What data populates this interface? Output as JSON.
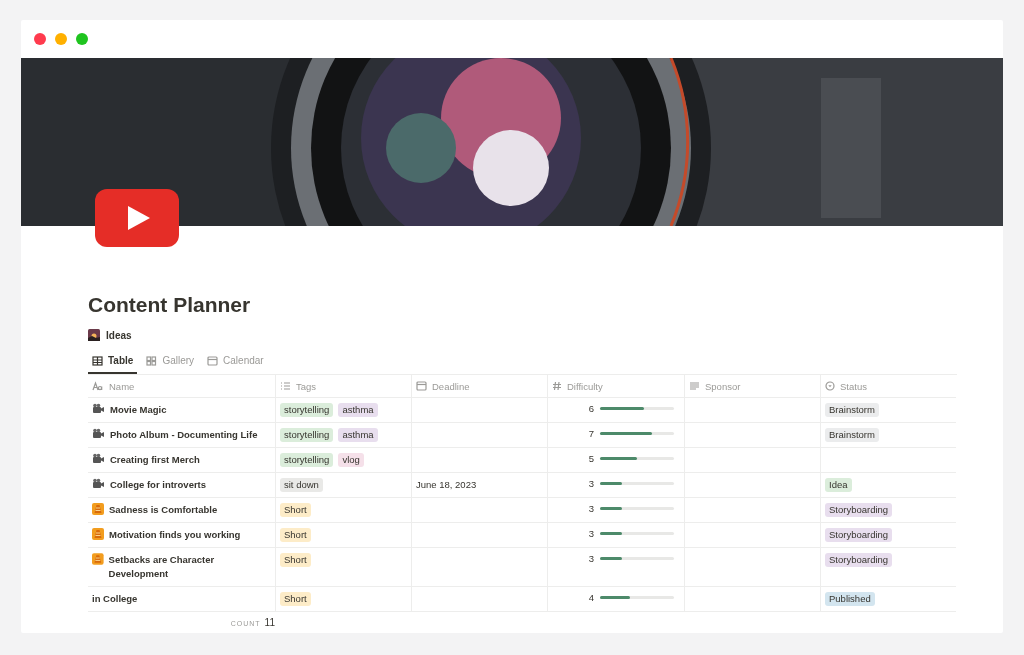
{
  "window": {
    "controls": [
      {
        "color": "#ff3b4e"
      },
      {
        "color": "#ffb000"
      },
      {
        "color": "#1fc41f"
      }
    ]
  },
  "page": {
    "title": "Content Planner",
    "subtitle": "Ideas"
  },
  "tabs": [
    {
      "label": "Table",
      "selected": true
    },
    {
      "label": "Gallery",
      "selected": false
    },
    {
      "label": "Calendar",
      "selected": false
    }
  ],
  "table": {
    "columns": [
      {
        "label": "Name"
      },
      {
        "label": "Tags"
      },
      {
        "label": "Deadline"
      },
      {
        "label": "Difficulty"
      },
      {
        "label": "Sponsor"
      },
      {
        "label": "Status"
      }
    ],
    "rows": [
      {
        "kind": "camera",
        "name": "Movie Magic",
        "tags": [
          {
            "label": "storytelling",
            "color": "#dbeddb"
          },
          {
            "label": "asthma",
            "color": "#e8deee"
          }
        ],
        "difficulty": "6",
        "level": 0.6,
        "status": {
          "label": "Brainstorm",
          "color": "#ebeced"
        }
      },
      {
        "kind": "camera",
        "name": "Photo Album - Documenting Life",
        "tags": [
          {
            "label": "storytelling",
            "color": "#dbeddb"
          },
          {
            "label": "asthma",
            "color": "#e8deee"
          }
        ],
        "difficulty": "7",
        "level": 0.7,
        "status": {
          "label": "Brainstorm",
          "color": "#ebeced"
        }
      },
      {
        "kind": "camera",
        "name": "Creating first Merch",
        "tags": [
          {
            "label": "storytelling",
            "color": "#dbeddb"
          },
          {
            "label": "vlog",
            "color": "#f5e0e9"
          }
        ],
        "difficulty": "5",
        "level": 0.5
      },
      {
        "kind": "camera",
        "name": "College for introverts",
        "tags": [
          {
            "label": "sit down",
            "color": "#e9e9e7"
          }
        ],
        "deadline": "June 18, 2023",
        "difficulty": "3",
        "level": 0.3,
        "status": {
          "label": "Idea",
          "color": "#dbeddb"
        }
      },
      {
        "kind": "cone",
        "name": "Sadness is Comfortable",
        "tags": [
          {
            "label": "Short",
            "color": "#fdecc8"
          }
        ],
        "difficulty": "3",
        "level": 0.3,
        "status": {
          "label": "Storyboarding",
          "color": "#e8deee"
        }
      },
      {
        "kind": "cone",
        "name": "Motivation finds you working",
        "tags": [
          {
            "label": "Short",
            "color": "#fdecc8"
          }
        ],
        "difficulty": "3",
        "level": 0.3,
        "status": {
          "label": "Storyboarding",
          "color": "#e8deee"
        }
      },
      {
        "kind": "cone",
        "name": "Setbacks are Character Development",
        "tags": [
          {
            "label": "Short",
            "color": "#fdecc8"
          }
        ],
        "difficulty": "3",
        "level": 0.3,
        "status": {
          "label": "Storyboarding",
          "color": "#e8deee"
        }
      },
      {
        "name": "in College",
        "tags": [
          {
            "label": "Short",
            "color": "#fdecc8"
          }
        ],
        "difficulty": "4",
        "level": 0.4,
        "status": {
          "label": "Published",
          "color": "#d3e5ef"
        }
      }
    ],
    "footer": {
      "label": "COUNT",
      "value": "11"
    }
  }
}
